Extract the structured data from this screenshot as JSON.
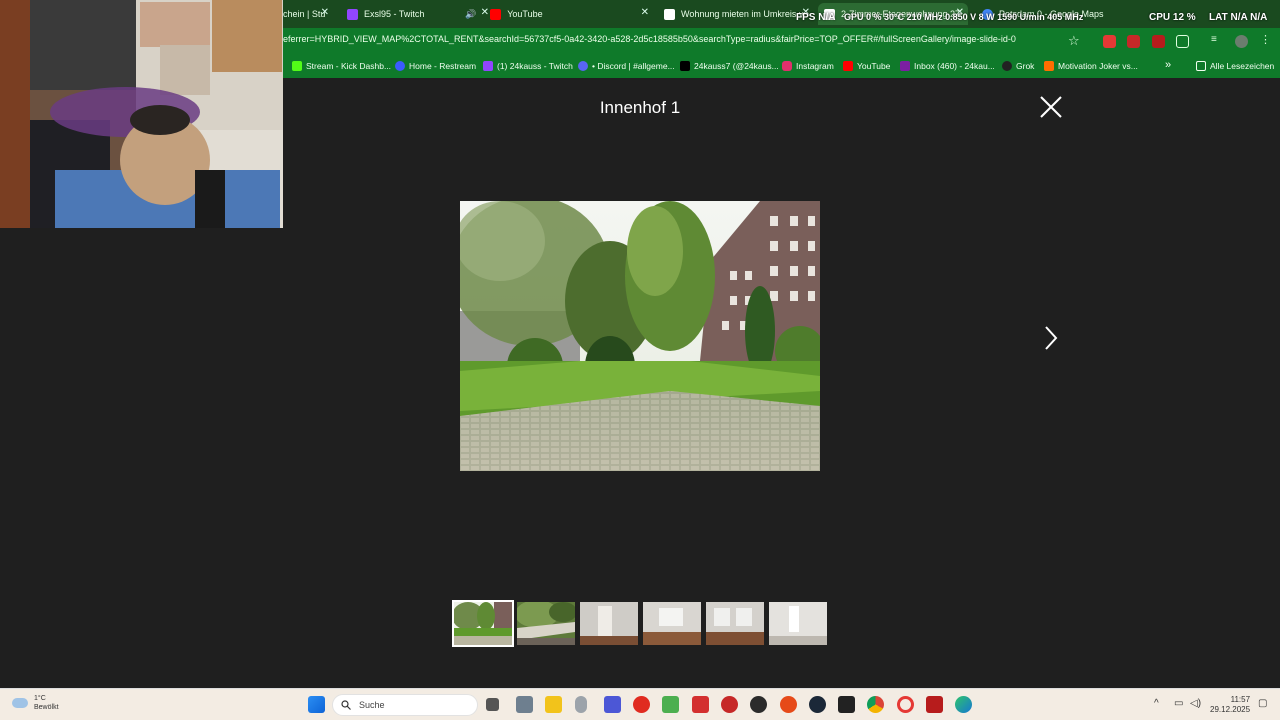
{
  "browser": {
    "tabs": [
      {
        "label": "chein | Stu",
        "icon": "page-icon",
        "color": "#1a4a1f"
      },
      {
        "label": "Exsl95 - Twitch",
        "icon": "twitch-icon",
        "color": "#9146ff"
      },
      {
        "label": "YouTube",
        "icon": "youtube-icon",
        "color": "#ff0000"
      },
      {
        "label": "Wohnung mieten im Umkreis v",
        "icon": "immo-icon",
        "color": "#ffffff"
      },
      {
        "label": "2-Zimmer-Etagenwohnung 27",
        "icon": "immo-icon",
        "color": "#ffffff"
      },
      {
        "label": "Potsdam 0 - Google Maps",
        "icon": "maps-icon",
        "color": "#4285f4"
      }
    ],
    "url": "eferrer=HYBRID_VIEW_MAP%2CTOTAL_RENT&searchId=56737cf5-0a42-3420-a528-2d5c18585b50&searchType=radius&fairPrice=TOP_OFFER#/fullScreenGallery/image-slide-id-0",
    "bookmarks": [
      {
        "label": "Stream - Kick Dashb...",
        "color": "#53fc18"
      },
      {
        "label": "Home - Restream",
        "color": "#3b5bfd"
      },
      {
        "label": "(1) 24kauss - Twitch",
        "color": "#9146ff"
      },
      {
        "label": "• Discord | #allgeme...",
        "color": "#5865f2"
      },
      {
        "label": "24kauss7 (@24kaus...",
        "color": "#000000"
      },
      {
        "label": "Instagram",
        "color": "#e1306c"
      },
      {
        "label": "YouTube",
        "color": "#ff0000"
      },
      {
        "label": "Inbox (460) - 24kau...",
        "color": "#7b1fa2"
      },
      {
        "label": "Grok",
        "color": "#222222"
      },
      {
        "label": "Motivation Joker vs...",
        "color": "#ff6d00"
      }
    ],
    "bookmarks_more": "»",
    "all_bookmarks": "Alle Lesezeichen",
    "stats": {
      "fps": "FPS N/A",
      "gpu": "GPU 0 %  30°C  210 MHz  0.850 V  8 W  1590 U/min  405 MHz",
      "cpu": "CPU 12 %",
      "lat": "LAT N/A  N/A"
    }
  },
  "gallery": {
    "title": "Innenhof 1",
    "close_label": "×",
    "next_label": "›",
    "thumbnails": [
      {
        "name": "courtyard",
        "active": true
      },
      {
        "name": "balcony-view",
        "active": false
      },
      {
        "name": "room-door",
        "active": false
      },
      {
        "name": "living-room",
        "active": false
      },
      {
        "name": "bedroom",
        "active": false
      },
      {
        "name": "bathroom",
        "active": false
      }
    ]
  },
  "taskbar": {
    "weather_temp": "1°C",
    "weather_desc": "Bewölkt",
    "search_placeholder": "Suche",
    "time": "11:57",
    "date": "29.12.2025"
  }
}
